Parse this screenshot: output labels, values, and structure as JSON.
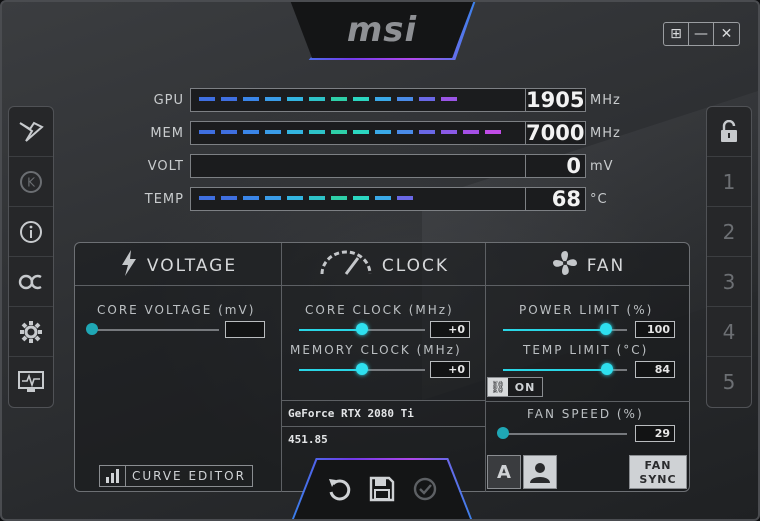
{
  "window": {
    "brand": "msi",
    "controls": [
      "⊞",
      "—",
      "✕"
    ]
  },
  "monitor": [
    {
      "label": "GPU",
      "value": "1905",
      "unit": "MHz",
      "fill_segments": 12,
      "colors": [
        "#3f6fe0",
        "#3f6fe0",
        "#3a85e8",
        "#3a9ce8",
        "#33b5e0",
        "#2ec3c8",
        "#2ecfa8",
        "#2bd6c0",
        "#3aa9e8",
        "#4a8be8",
        "#6a68e6",
        "#9a55e6"
      ]
    },
    {
      "label": "MEM",
      "value": "7000",
      "unit": "MHz",
      "fill_segments": 14,
      "colors": [
        "#3f6fe0",
        "#3f6fe0",
        "#3a85e8",
        "#3a9ce8",
        "#33b5e0",
        "#2ec3c8",
        "#2ecfa8",
        "#2bd6c0",
        "#3aa9e8",
        "#4a8be8",
        "#6a68e6",
        "#8a5ae6",
        "#a44fe6",
        "#c04ce6"
      ]
    },
    {
      "label": "VOLT",
      "value": "0",
      "unit": "mV",
      "fill_segments": 0,
      "colors": []
    },
    {
      "label": "TEMP",
      "value": "68",
      "unit": "°C",
      "fill_segments": 10,
      "colors": [
        "#3f6fe0",
        "#3f6fe0",
        "#3a85e8",
        "#3a9ce8",
        "#33b5e0",
        "#2ec3c8",
        "#2ecfa8",
        "#2bd6c0",
        "#3aa9e8",
        "#6a68e6"
      ]
    }
  ],
  "left_sidebar": [
    "msi-dragon-icon",
    "k-icon",
    "info-icon",
    "oc-scanner-icon",
    "settings-icon",
    "monitor-icon"
  ],
  "right_sidebar": {
    "lock": "lock-icon",
    "profiles": [
      "1",
      "2",
      "3",
      "4",
      "5"
    ]
  },
  "voltage": {
    "title": "VOLTAGE",
    "core_voltage_label": "CORE VOLTAGE  (mV)",
    "core_voltage_value": "",
    "core_voltage_level": 0.0,
    "curve_editor": "CURVE EDITOR"
  },
  "clock": {
    "title": "CLOCK",
    "core_clock_label": "CORE CLOCK (MHz)",
    "core_clock_value": "+0",
    "core_clock_level": 0.5,
    "memory_clock_label": "MEMORY CLOCK (MHz)",
    "memory_clock_value": "+0",
    "memory_clock_level": 0.5,
    "gpu_name": "GeForce RTX 2080 Ti",
    "driver_version": "451.85"
  },
  "fan": {
    "title": "FAN",
    "power_limit_label": "POWER LIMIT (%)",
    "power_limit_value": "100",
    "power_limit_level": 0.83,
    "temp_limit_label": "TEMP LIMIT (°C)",
    "temp_limit_value": "84",
    "temp_limit_level": 0.84,
    "link_label": "ON",
    "fan_speed_label": "FAN SPEED (%)",
    "fan_speed_value": "29",
    "fan_speed_level": 0.0,
    "auto_label": "A",
    "fan_sync_line1": "FAN",
    "fan_sync_line2": "SYNC"
  },
  "bottom_actions": [
    "reset-icon",
    "save-icon",
    "apply-icon"
  ]
}
